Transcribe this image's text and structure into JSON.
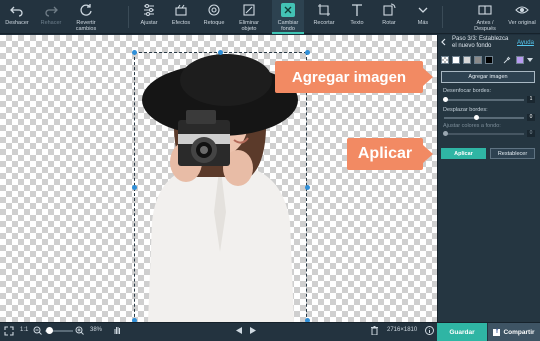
{
  "toolbar": {
    "undo": "Deshacer",
    "redo": "Rehacer",
    "revert": "Revertir cambios",
    "adjust": "Ajustar",
    "effects": "Efectos",
    "retouch": "Retoque",
    "erase": "Eliminar objeto",
    "change_bg": "Cambiar fondo",
    "crop": "Recortar",
    "text": "Texto",
    "rotate": "Rotar",
    "more": "Más",
    "before_after": "Antes / Después",
    "view_original": "Ver original"
  },
  "callouts": {
    "add_image": "Agregar imagen",
    "apply": "Aplicar"
  },
  "panel": {
    "step": "Paso 3/3: Establezca el nuevo fondo",
    "help": "Ayuda",
    "add_image_button": "Agregar imagen",
    "blur_label": "Desenfocar bordes:",
    "blur_value": "1",
    "shift_label": "Desplazar bordes:",
    "shift_value": "0",
    "colors_label": "Ajustar colores a fondo:",
    "colors_value": "0",
    "apply_button": "Aplicar",
    "reset_button": "Restablecer",
    "swatch_colors": [
      "#ffffff",
      "#d9d9d9",
      "#8a8a8a",
      "#000000"
    ],
    "picked_color": "#b79bf0"
  },
  "bottom": {
    "ratio": "1:1",
    "zoom": "38%",
    "dimensions": "2716×1810",
    "save": "Guardar",
    "share": "Compartir"
  },
  "colors": {
    "accent": "#2fb5a4",
    "callout": "#f28a63"
  }
}
